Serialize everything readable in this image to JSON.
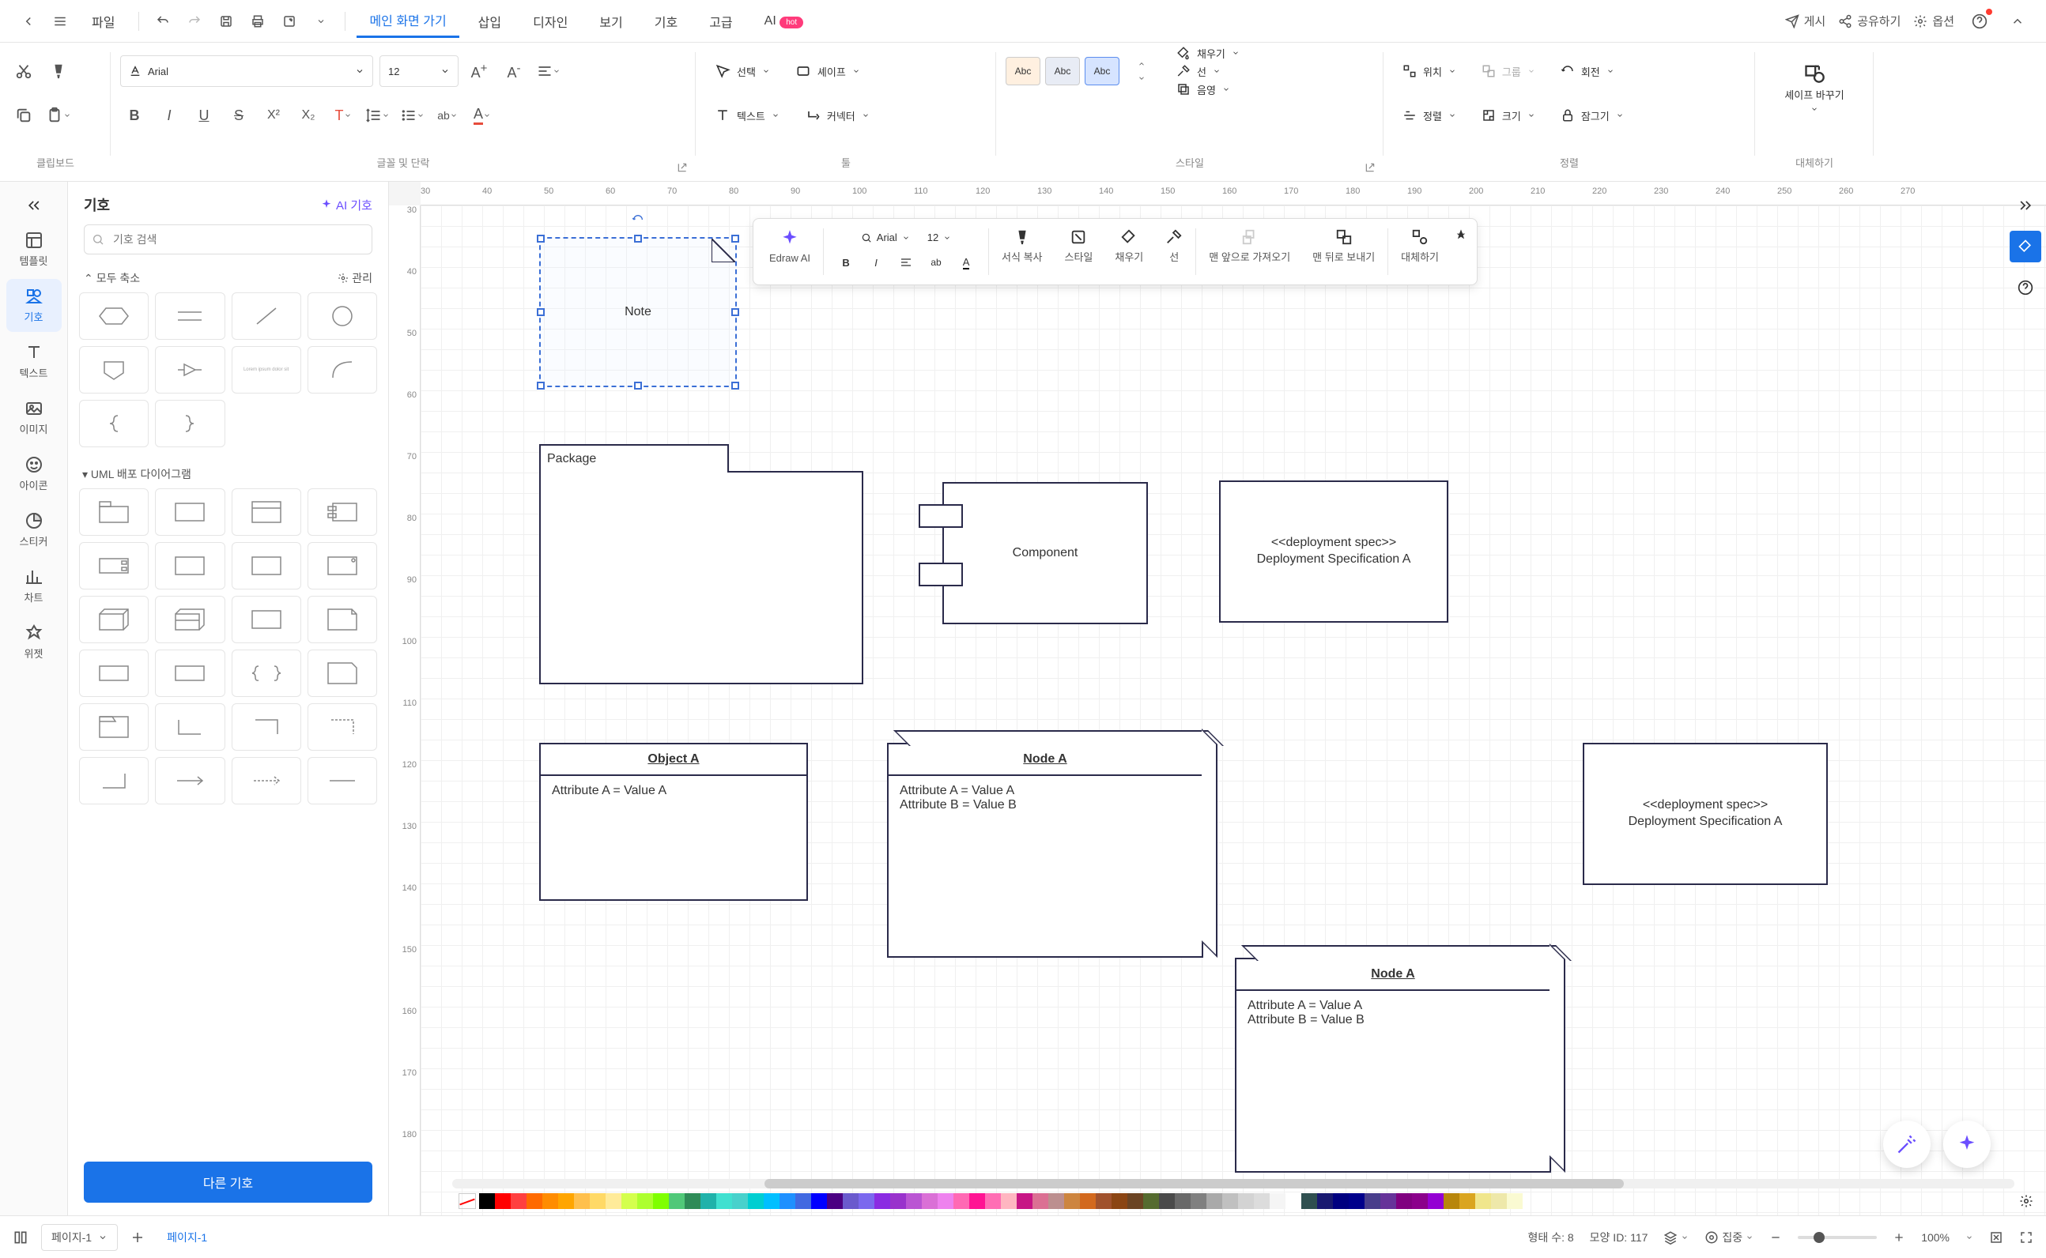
{
  "top_menu": {
    "file": "파일",
    "items": [
      "메인 화면 가기",
      "삽입",
      "디자인",
      "보기",
      "기호",
      "고급",
      "AI"
    ],
    "active_index": 0,
    "right": {
      "publish": "게시",
      "share": "공유하기",
      "options": "옵션",
      "hot": "hot"
    }
  },
  "ribbon": {
    "clipboard": {
      "label": "클립보드"
    },
    "font": {
      "name": "Arial",
      "size": "12",
      "label": "글꼴 및 단락"
    },
    "tool": {
      "select": "선택",
      "text": "텍스트",
      "shape": "셰이프",
      "connector": "커넥터",
      "label": "툴"
    },
    "style": {
      "swatch": "Abc",
      "fill": "채우기",
      "line": "선",
      "shadow": "음영",
      "label": "스타일"
    },
    "arrange": {
      "position": "위치",
      "align": "정렬",
      "group": "그룹",
      "size": "크기",
      "rotate": "회전",
      "lock": "잠그기",
      "label": "정렬"
    },
    "replace": {
      "shape_change": "셰이프 바꾸기",
      "label": "대체하기"
    }
  },
  "left_nav": {
    "items": [
      {
        "label": "템플릿"
      },
      {
        "label": "기호"
      },
      {
        "label": "텍스트"
      },
      {
        "label": "이미지"
      },
      {
        "label": "아이콘"
      },
      {
        "label": "스티커"
      },
      {
        "label": "차트"
      },
      {
        "label": "위젯"
      }
    ],
    "active_index": 1
  },
  "symbol_panel": {
    "title": "기호",
    "ai": "AI 기호",
    "search_placeholder": "기호 검색",
    "collapse_all": "모두 축소",
    "manage": "관리",
    "group1": "UML 배포 다이어그램",
    "more": "다른 기호"
  },
  "ruler_h": [
    "30",
    "40",
    "50",
    "60",
    "70",
    "80",
    "90",
    "100",
    "110",
    "120",
    "130",
    "140",
    "150",
    "160",
    "170",
    "180",
    "190",
    "200",
    "210",
    "220",
    "230",
    "240",
    "250",
    "260",
    "270"
  ],
  "ruler_v": [
    "30",
    "40",
    "50",
    "60",
    "70",
    "80",
    "90",
    "100",
    "110",
    "120",
    "130",
    "140",
    "150",
    "160",
    "170",
    "180"
  ],
  "shapes": {
    "note": "Note",
    "package": "Package",
    "component": "Component",
    "depspec": "<<deployment spec>>\nDeployment Specification A",
    "object_a": {
      "title": "Object A",
      "attr": "Attribute A = Value A"
    },
    "node_a": {
      "title": "Node A",
      "attr1": "Attribute A = Value A",
      "attr2": "Attribute B = Value B"
    },
    "node_a2": {
      "title": "Node A",
      "attr1": "Attribute A = Value A",
      "attr2": "Attribute B = Value B"
    },
    "depspec2": "<<deployment spec>>\nDeployment Specification A"
  },
  "float_toolbar": {
    "edraw_ai": "Edraw AI",
    "font": "Arial",
    "size": "12",
    "format_paint": "서식 복사",
    "style": "스타일",
    "fill": "채우기",
    "line": "선",
    "bring_front": "맨 앞으로 가져오기",
    "send_back": "맨 뒤로 보내기",
    "replace": "대체하기"
  },
  "status": {
    "page_dropdown": "페이지-1",
    "page_tab": "페이지-1",
    "shape_count_label": "형태 수:",
    "shape_count": "8",
    "shape_id_label": "모양 ID:",
    "shape_id": "117",
    "focus": "집중",
    "zoom": "100%"
  },
  "colors": [
    "#000000",
    "#ff0000",
    "#ff4040",
    "#ff6a00",
    "#ff8c00",
    "#ffa500",
    "#ffc04d",
    "#ffd966",
    "#ffeb99",
    "#d4ff4d",
    "#adff2f",
    "#7fff00",
    "#50c878",
    "#2e8b57",
    "#20b2aa",
    "#40e0d0",
    "#48d1cc",
    "#00ced1",
    "#00bfff",
    "#1e90ff",
    "#4169e1",
    "#0000ff",
    "#4b0082",
    "#6a5acd",
    "#7b68ee",
    "#8a2be2",
    "#9932cc",
    "#ba55d3",
    "#da70d6",
    "#ee82ee",
    "#ff69b4",
    "#ff1493",
    "#ff6eb4",
    "#ffb6c1",
    "#c71585",
    "#db7093",
    "#bc8f8f",
    "#cd853f",
    "#d2691e",
    "#a0522d",
    "#8b4513",
    "#6b4423",
    "#556b2f",
    "#4a4a4a",
    "#696969",
    "#808080",
    "#a9a9a9",
    "#c0c0c0",
    "#d3d3d3",
    "#dcdcdc",
    "#f5f5f5",
    "#ffffff",
    "#2f4f4f",
    "#191970",
    "#000080",
    "#00008b",
    "#483d8b",
    "#663399",
    "#800080",
    "#8b008b",
    "#9400d3",
    "#b8860b",
    "#daa520",
    "#f0e68c",
    "#eee8aa",
    "#fafad2"
  ]
}
